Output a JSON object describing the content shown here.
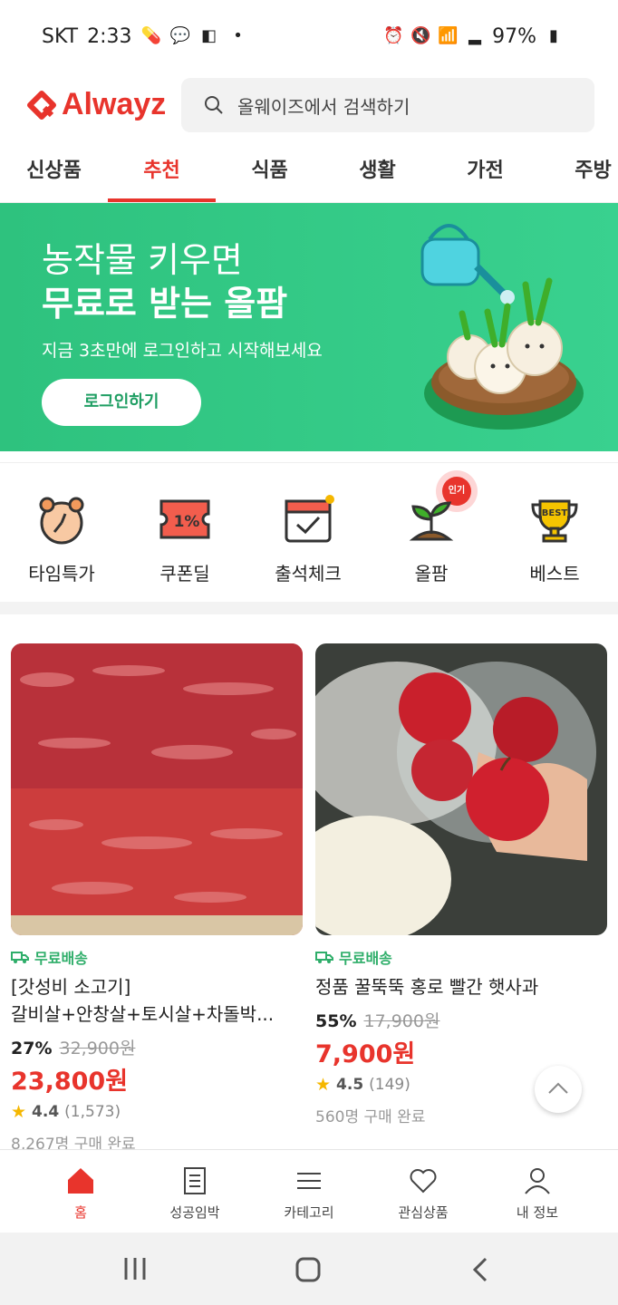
{
  "status_bar": {
    "carrier": "SKT",
    "time": "2:33",
    "battery": "97%"
  },
  "header": {
    "logo_text": "Alwayz",
    "search_placeholder": "올웨이즈에서 검색하기"
  },
  "tabs": [
    {
      "label": "신상품",
      "active": false
    },
    {
      "label": "추천",
      "active": true
    },
    {
      "label": "식품",
      "active": false
    },
    {
      "label": "생활",
      "active": false
    },
    {
      "label": "가전",
      "active": false
    },
    {
      "label": "주방",
      "active": false
    }
  ],
  "banner": {
    "line1": "농작물 키우면",
    "line2": "무료로 받는 올팜",
    "sub": "지금 3초만에 로그인하고 시작해보세요",
    "button": "로그인하기"
  },
  "quick_menu": [
    {
      "label": "타임특가",
      "icon": "alarm-clock-icon"
    },
    {
      "label": "쿠폰딜",
      "icon": "coupon-icon",
      "icon_text": "1%"
    },
    {
      "label": "출석체크",
      "icon": "calendar-check-icon"
    },
    {
      "label": "올팜",
      "icon": "sprout-icon",
      "badge": "인기"
    },
    {
      "label": "베스트",
      "icon": "trophy-icon",
      "icon_text": "BEST"
    }
  ],
  "products": [
    {
      "shipping": "무료배송",
      "name_line1": "[갓성비 소고기]",
      "name_line2": "갈비살+안창살+토시살+차돌박...",
      "discount": "27%",
      "original_price": "32,900원",
      "price": "23,800원",
      "rating": "4.4",
      "reviews": "(1,573)",
      "sold": "8,267명 구매 완료"
    },
    {
      "shipping": "무료배송",
      "name_line1": "정품 꿀뚝뚝 홍로 빨간 햇사과",
      "discount": "55%",
      "original_price": "17,900원",
      "price": "7,900원",
      "rating": "4.5",
      "reviews": "(149)",
      "sold": "560명 구매 완료"
    }
  ],
  "bottom_nav": [
    {
      "label": "홈",
      "icon": "home-icon",
      "active": true
    },
    {
      "label": "성공임박",
      "icon": "document-icon",
      "active": false
    },
    {
      "label": "카테고리",
      "icon": "menu-icon",
      "active": false
    },
    {
      "label": "관심상품",
      "icon": "heart-icon",
      "active": false
    },
    {
      "label": "내 정보",
      "icon": "user-icon",
      "active": false
    }
  ],
  "colors": {
    "brand": "#e8342c",
    "banner": "#2ec27e",
    "shipping": "#2fae6a"
  }
}
